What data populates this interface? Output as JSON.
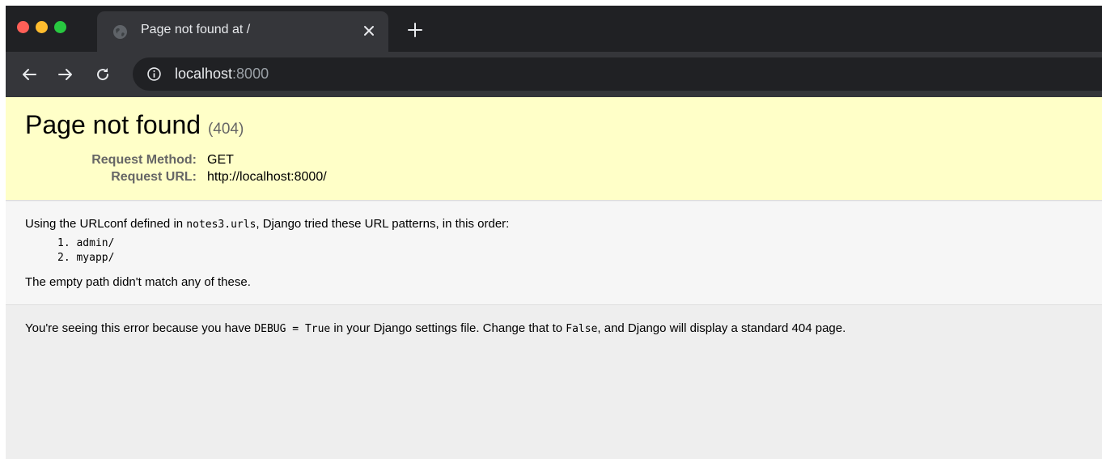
{
  "window": {
    "controls": {
      "close_color": "#ff5f57",
      "minimize_color": "#febc2e",
      "maximize_color": "#28c840"
    }
  },
  "tabs": [
    {
      "title": "Page not found at /",
      "icon": "globe-icon",
      "active": true
    }
  ],
  "toolbar": {
    "back_icon": "arrow-left-icon",
    "forward_icon": "arrow-right-icon",
    "reload_icon": "reload-icon",
    "address": {
      "host": "localhost",
      "port": ":8000",
      "icon": "info-icon"
    }
  },
  "summary": {
    "title": "Page not found",
    "status": "(404)",
    "background": "#ffffc8",
    "meta": [
      {
        "key": "Request Method:",
        "value": "GET"
      },
      {
        "key": "Request URL:",
        "value": "http://localhost:8000/"
      }
    ]
  },
  "info": {
    "intro_prefix": "Using the URLconf defined in ",
    "urlconf": "notes3.urls",
    "intro_suffix": ", Django tried these URL patterns, in this order:",
    "patterns": [
      {
        "num": "1.",
        "pattern": "admin/"
      },
      {
        "num": "2.",
        "pattern": "myapp/"
      }
    ],
    "no_match": "The empty path didn't match any of these."
  },
  "explanation": {
    "prefix": "You're seeing this error because you have ",
    "debug_setting": "DEBUG = True",
    "middle": " in your Django settings file. Change that to ",
    "false_value": "False",
    "suffix": ", and Django will display a standard 404 page."
  }
}
